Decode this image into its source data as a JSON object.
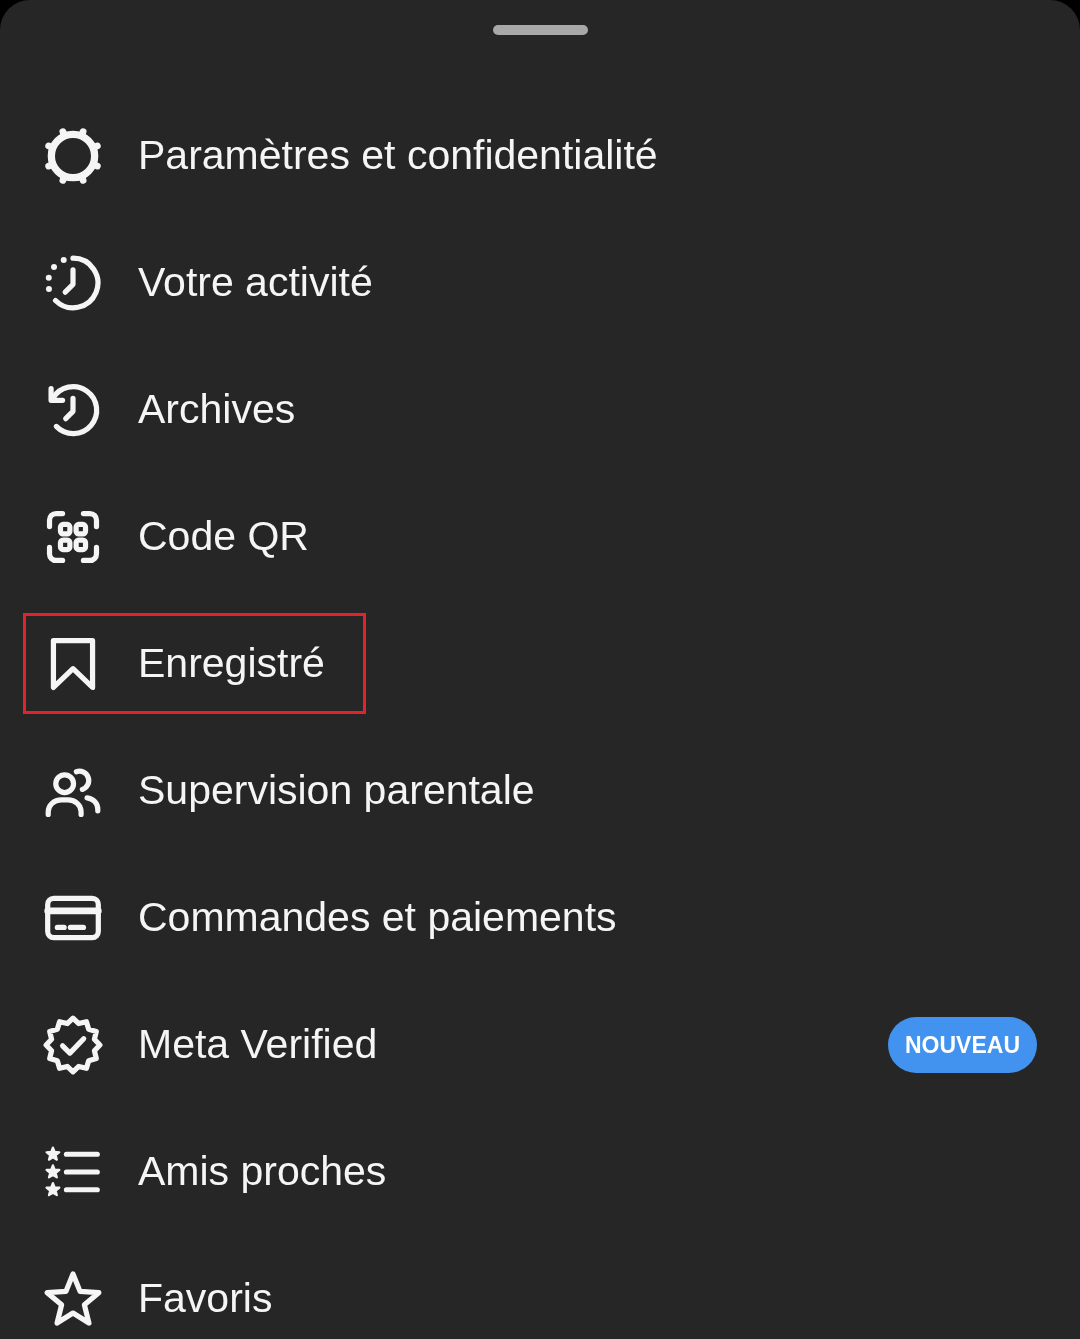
{
  "sheet": {
    "menu_items": [
      {
        "label": "Paramètres et confidentialité",
        "highlighted": false
      },
      {
        "label": "Votre activité",
        "highlighted": false
      },
      {
        "label": "Archives",
        "highlighted": false
      },
      {
        "label": "Code QR",
        "highlighted": false
      },
      {
        "label": "Enregistré",
        "highlighted": true
      },
      {
        "label": "Supervision parentale",
        "highlighted": false
      },
      {
        "label": "Commandes et paiements",
        "highlighted": false
      },
      {
        "label": "Meta Verified",
        "highlighted": false,
        "badge": "NOUVEAU"
      },
      {
        "label": "Amis proches",
        "highlighted": false
      },
      {
        "label": "Favoris",
        "highlighted": false
      }
    ]
  }
}
